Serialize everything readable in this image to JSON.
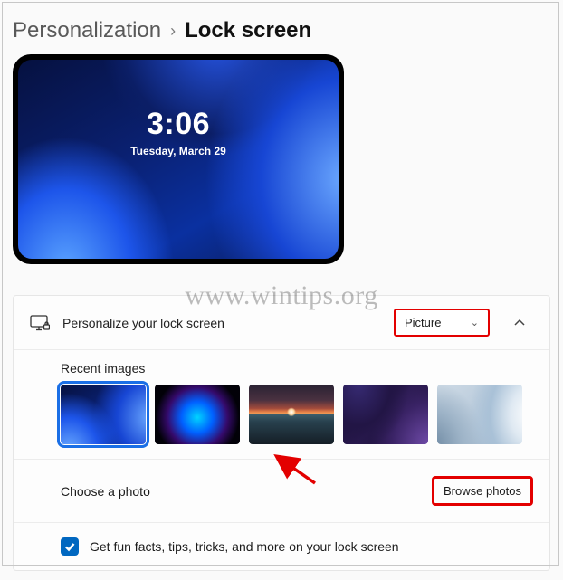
{
  "breadcrumb": {
    "parent": "Personalization",
    "current": "Lock screen"
  },
  "preview": {
    "time": "3:06",
    "date": "Tuesday, March 29"
  },
  "personalize": {
    "label": "Personalize your lock screen",
    "dropdown_value": "Picture"
  },
  "recent": {
    "title": "Recent images"
  },
  "choose": {
    "label": "Choose a photo",
    "button": "Browse photos"
  },
  "funfacts": {
    "label": "Get fun facts, tips, tricks, and more on your lock screen",
    "checked": true
  },
  "watermark": "www.wintips.org"
}
